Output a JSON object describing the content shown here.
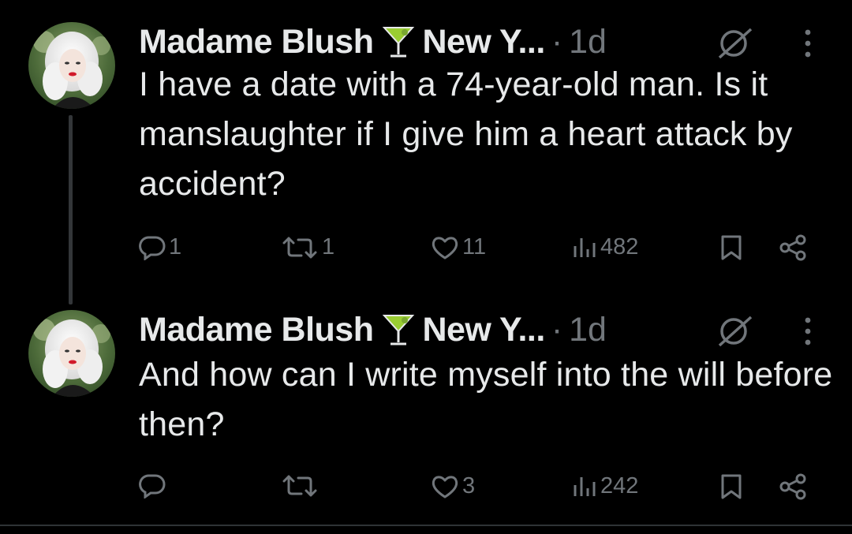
{
  "thread": [
    {
      "author": {
        "name": "Madame Blush",
        "name_emoji": "cocktail-glass-emoji",
        "location": "New Y...",
        "separator": "·",
        "time": "1d"
      },
      "text": "I have a date with a 74-year-old man. Is it manslaughter if I give him a heart attack by accident?",
      "actions": {
        "replies": "1",
        "reposts": "1",
        "likes": "11",
        "views": "482"
      }
    },
    {
      "author": {
        "name": "Madame Blush",
        "name_emoji": "cocktail-glass-emoji",
        "location": "New Y...",
        "separator": "·",
        "time": "1d"
      },
      "text": "And how can I write myself into the will before then?",
      "actions": {
        "replies": "",
        "reposts": "",
        "likes": "3",
        "views": "242"
      }
    }
  ],
  "icons": [
    "reply-icon",
    "repost-icon",
    "like-icon",
    "views-icon",
    "bookmark-icon",
    "share-icon",
    "grok-icon",
    "more-icon"
  ],
  "colors": {
    "background": "#000000",
    "text": "#e7e9ea",
    "muted": "#71767b",
    "thread_line": "#333639"
  }
}
